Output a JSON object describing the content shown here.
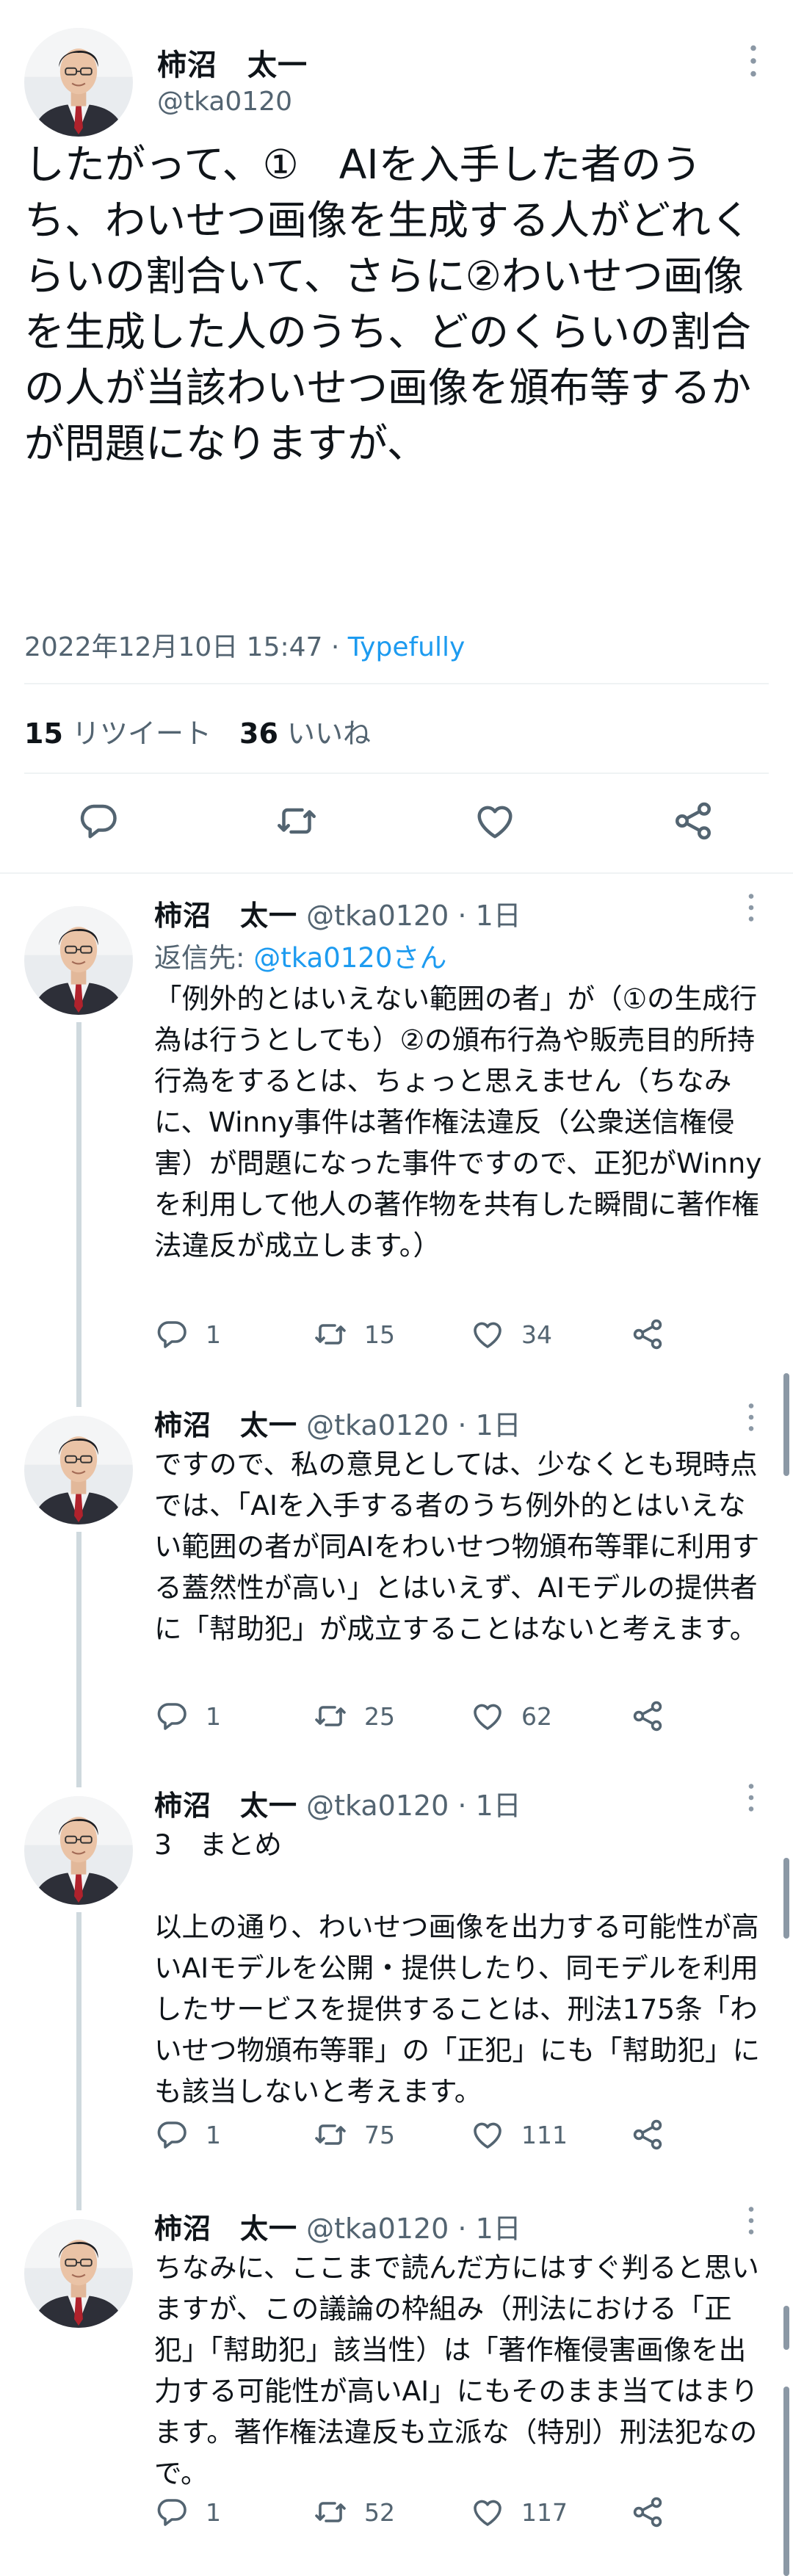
{
  "main_tweet": {
    "author_name": "柿沼　太一",
    "handle": "@tka0120",
    "text": "したがって、①　AIを入手した者のうち、わいせつ画像を生成する人がどれくらいの割合いて、さらに②わいせつ画像を生成した人のうち、どのくらいの割合の人が当該わいせつ画像を頒布等するかが問題になりますが、",
    "timestamp": "2022年12月10日 15:47",
    "separator": " · ",
    "via": "Typefully",
    "retweet_count": "15",
    "retweet_label": "リツイート",
    "like_count": "36",
    "like_label": "いいね"
  },
  "replies": [
    {
      "author_name": "柿沼　太一",
      "handle": "@tka0120",
      "time": " · 1日",
      "reply_to_label": "返信先: ",
      "reply_to": "@tka0120さん",
      "text": "「例外的とはいえない範囲の者」が（①の生成行為は行うとしても）②の頒布行為や販売目的所持行為をするとは、ちょっと思えません（ちなみに、Winny事件は著作権法違反（公衆送信権侵害）が問題になった事件ですので、正犯がWinnyを利用して他人の著作物を共有した瞬間に著作権法違反が成立します。）",
      "replies": "1",
      "retweets": "15",
      "likes": "34"
    },
    {
      "author_name": "柿沼　太一",
      "handle": "@tka0120",
      "time": " · 1日",
      "text": "ですので、私の意見としては、少なくとも現時点では、「AIを入手する者のうち例外的とはいえない範囲の者が同AIをわいせつ物頒布等罪に利用する蓋然性が高い」とはいえず、AIモデルの提供者に「幇助犯」が成立することはないと考えます。",
      "replies": "1",
      "retweets": "25",
      "likes": "62"
    },
    {
      "author_name": "柿沼　太一",
      "handle": "@tka0120",
      "time": " · 1日",
      "text": "3　まとめ\n\n以上の通り、わいせつ画像を出力する可能性が高いAIモデルを公開・提供したり、同モデルを利用したサービスを提供することは、刑法175条「わいせつ物頒布等罪」の「正犯」にも「幇助犯」にも該当しないと考えます。",
      "replies": "1",
      "retweets": "75",
      "likes": "111"
    },
    {
      "author_name": "柿沼　太一",
      "handle": "@tka0120",
      "time": " · 1日",
      "text": "ちなみに、ここまで読んだ方にはすぐ判ると思いますが、この議論の枠組み（刑法における「正犯」「幇助犯」該当性）は「著作権侵害画像を出力する可能性が高いAI」にもそのまま当てはまります。著作権法違反も立派な（特別）刑法犯なので。",
      "replies": "1",
      "retweets": "52",
      "likes": "117"
    }
  ],
  "colors": {
    "text": "#0f1419",
    "secondary": "#536471",
    "link": "#1d9bf0",
    "divider": "#eff3f4",
    "thread_line": "#cfd9de"
  },
  "icons": [
    "avatar-photo",
    "more-icon",
    "reply-icon",
    "retweet-icon",
    "like-icon",
    "share-icon"
  ]
}
